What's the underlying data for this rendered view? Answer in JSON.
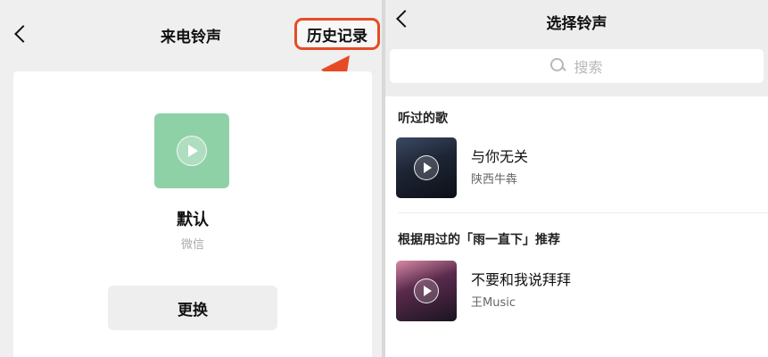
{
  "left": {
    "title": "来电铃声",
    "history_label": "历史记录",
    "ringtone": {
      "name": "默认",
      "source": "微信",
      "icon": "play-icon"
    },
    "change_label": "更换",
    "annotation_color": "#e64b26"
  },
  "right": {
    "title": "选择铃声",
    "search": {
      "placeholder": "搜索",
      "icon": "search-icon"
    },
    "sections": [
      {
        "title": "听过的歌",
        "songs": [
          {
            "title": "与你无关",
            "artist": "陕西牛犇"
          }
        ]
      },
      {
        "title": "根据用过的「雨一直下」推荐",
        "songs": [
          {
            "title": "不要和我说拜拜",
            "artist": "王Music"
          }
        ]
      }
    ]
  },
  "colors": {
    "ringtone_icon_bg": "#8fd1a7",
    "page_bg": "#efefef",
    "card_bg": "#ffffff"
  }
}
